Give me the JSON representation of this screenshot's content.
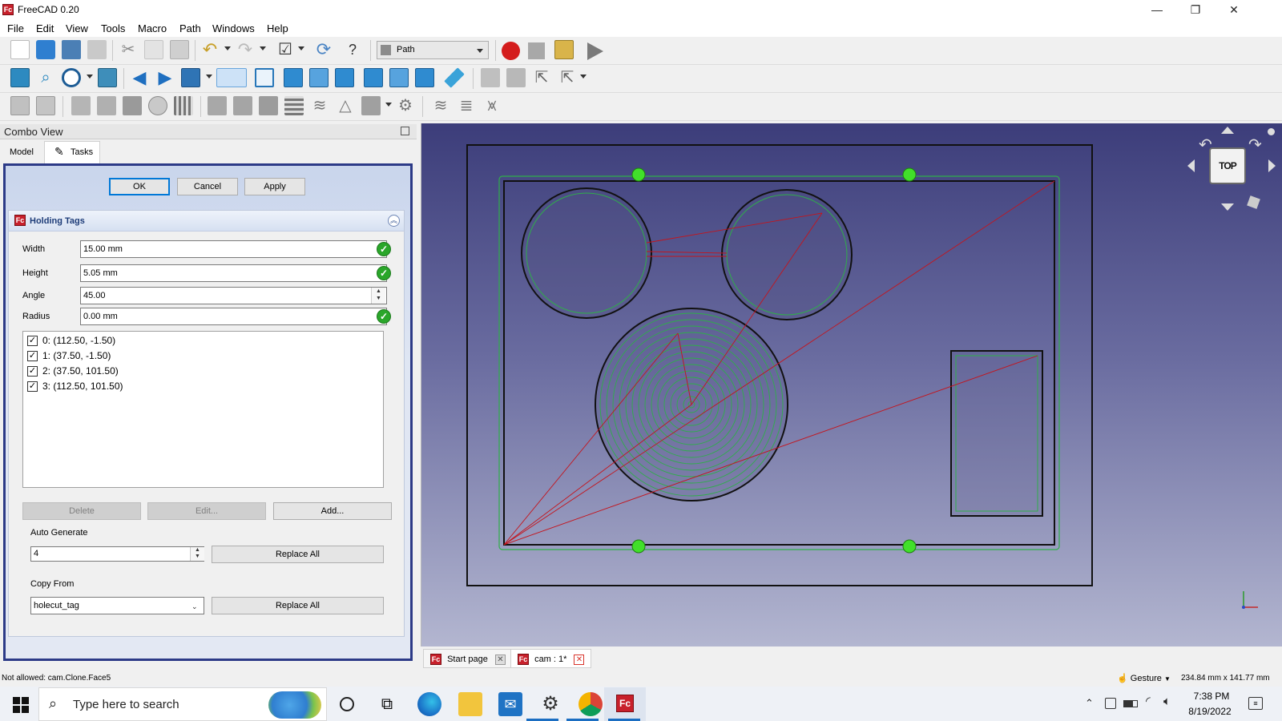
{
  "window": {
    "title": "FreeCAD 0.20",
    "logo_text": "Fc"
  },
  "window_controls": {
    "minimize": "—",
    "maximize": "❐",
    "close": "✕"
  },
  "menu": [
    "File",
    "Edit",
    "View",
    "Tools",
    "Macro",
    "Path",
    "Windows",
    "Help"
  ],
  "toolbar": {
    "workbench": "Path"
  },
  "combo": {
    "title": "Combo View",
    "tabs": [
      "Model",
      "Tasks"
    ]
  },
  "task_buttons": {
    "ok": "OK",
    "cancel": "Cancel",
    "apply": "Apply"
  },
  "holding_tags": {
    "title": "Holding Tags",
    "fields": {
      "width_label": "Width",
      "width_value": "15.00 mm",
      "height_label": "Height",
      "height_value": "5.05 mm",
      "angle_label": "Angle",
      "angle_value": "45.00",
      "radius_label": "Radius",
      "radius_value": "0.00 mm"
    },
    "tags": [
      "0: (112.50, -1.50)",
      "1: (37.50, -1.50)",
      "2: (37.50, 101.50)",
      "3: (112.50, 101.50)"
    ],
    "buttons": {
      "delete": "Delete",
      "edit": "Edit...",
      "add": "Add..."
    },
    "auto_generate": {
      "label": "Auto Generate",
      "value": "4",
      "button": "Replace All"
    },
    "copy_from": {
      "label": "Copy From",
      "value": "holecut_tag",
      "button": "Replace All"
    }
  },
  "navcube": {
    "face": "TOP"
  },
  "doc_tabs": [
    {
      "label": "Start page",
      "active": false
    },
    {
      "label": "cam : 1*",
      "active": true
    }
  ],
  "status": {
    "message": "Not allowed: cam.Clone.Face5",
    "nav_style": "Gesture",
    "dimensions": "234.84 mm x 141.77 mm"
  },
  "taskbar": {
    "search_placeholder": "Type here to search",
    "time": "7:38 PM",
    "date": "8/19/2022"
  }
}
